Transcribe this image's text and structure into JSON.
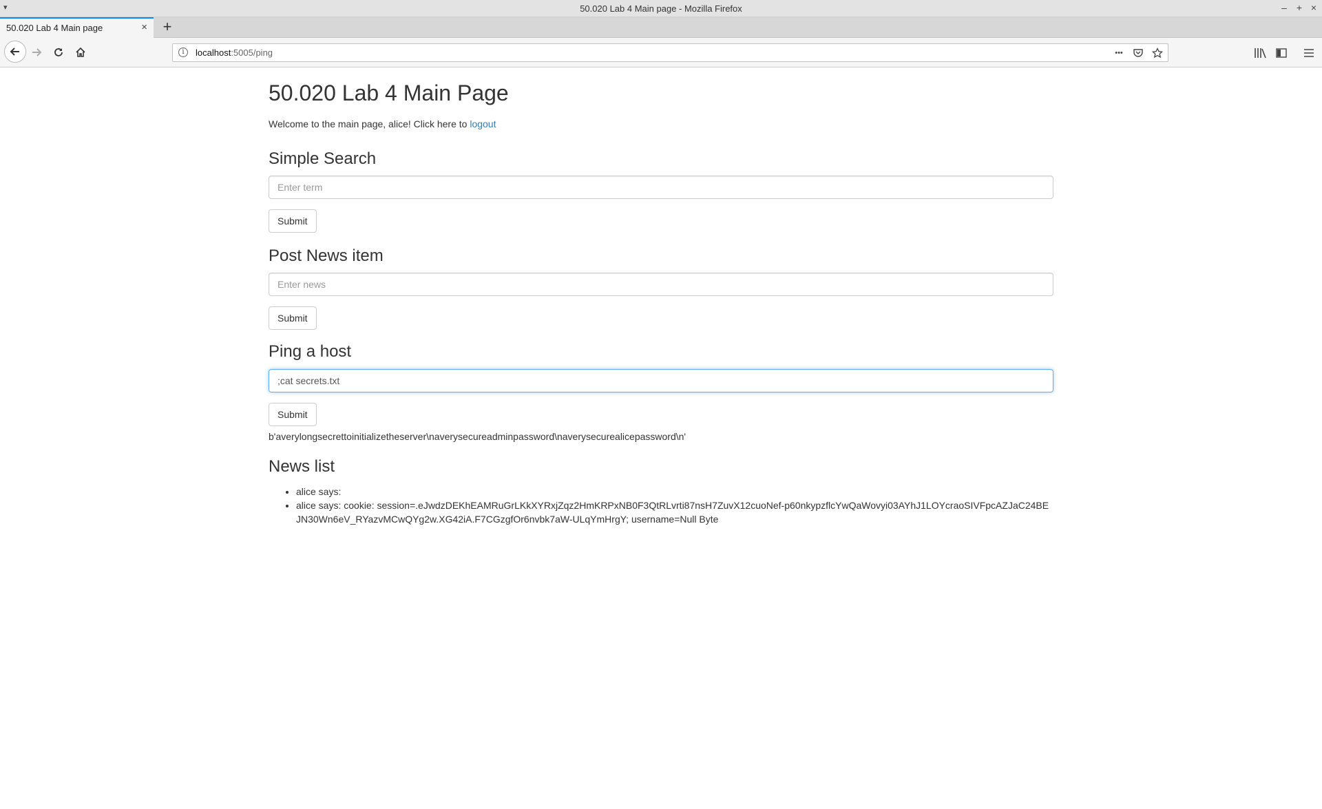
{
  "window": {
    "title": "50.020 Lab 4 Main page - Mozilla Firefox",
    "controls": [
      "–",
      "+",
      "×"
    ]
  },
  "tabs": [
    {
      "label": "50.020 Lab 4 Main page",
      "close": "×",
      "active": true
    }
  ],
  "new_tab_label": "+",
  "address_bar": {
    "host": "localhost",
    "rest": ":5005/ping",
    "info": "i",
    "actions_label": "•••"
  },
  "page": {
    "heading": "50.020 Lab 4 Main Page",
    "welcome_text": "Welcome to the main page, alice! Click here to ",
    "logout_link": "logout",
    "search": {
      "heading": "Simple Search",
      "placeholder": "Enter term",
      "value": "",
      "submit": "Submit"
    },
    "post_news": {
      "heading": "Post News item",
      "placeholder": "Enter news",
      "value": "",
      "submit": "Submit"
    },
    "ping": {
      "heading": "Ping a host",
      "value": ";cat secrets.txt",
      "submit": "Submit",
      "output": "b'averylongsecrettoinitializetheserver\\naverysecureadminpassword\\naverysecurealicepassword\\n'"
    },
    "news": {
      "heading": "News list",
      "items": [
        "alice says:",
        "alice says: cookie: session=.eJwdzDEKhEAMRuGrLKkXYRxjZqz2HmKRPxNB0F3QtRLvrti87nsH7ZuvX12cuoNef-p60nkypzflcYwQaWovyi03AYhJ1LOYcraoSIVFpcAZJaC24BEJN30Wn6eV_RYazvMCwQYg2w.XG42iA.F7CGzgfOr6nvbk7aW-ULqYmHrgY; username=Null Byte"
      ]
    }
  },
  "colors": {
    "link": "#337ab7",
    "tab_accent": "#0a84ff",
    "focus_border": "#66afe9"
  }
}
